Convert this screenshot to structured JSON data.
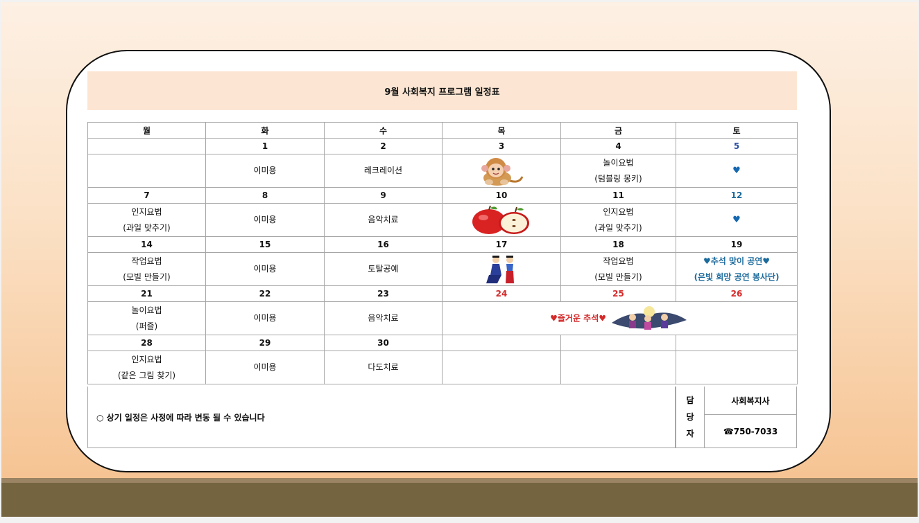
{
  "title": "9월 사회복지 프로그램 일정표",
  "weekdays": [
    "월",
    "화",
    "수",
    "목",
    "금",
    "토"
  ],
  "colors": {
    "saturday": "#1568b0",
    "holiday": "#d42a2a",
    "title_bg": "#fce6d3"
  },
  "week1": {
    "dates": [
      "",
      "1",
      "2",
      "3",
      "4",
      "5"
    ],
    "events": {
      "tue": "이미용",
      "wed": "레크레이션",
      "thu_icon": "monkey-illustration",
      "fri_line1": "놀이요법",
      "fri_line2": "(텀블링 몽키)",
      "sat": "♥"
    }
  },
  "week2": {
    "dates": [
      "7",
      "8",
      "9",
      "10",
      "11",
      "12"
    ],
    "events": {
      "mon_line1": "인지요법",
      "mon_line2": "(과일 맞추기)",
      "tue": "이미용",
      "wed": "음악치료",
      "thu_icon": "apple-illustration",
      "fri_line1": "인지요법",
      "fri_line2": "(과일 맞추기)",
      "sat": "♥"
    }
  },
  "week3": {
    "dates": [
      "14",
      "15",
      "16",
      "17",
      "18",
      "19"
    ],
    "events": {
      "mon_line1": "작업요법",
      "mon_line2": "(모빌 만들기)",
      "tue": "이미용",
      "wed": "토탈공예",
      "thu_icon": "hanbok-couple-illustration",
      "fri_line1": "작업요법",
      "fri_line2": "(모빌 만들기)",
      "sat_line1": "♥추석 맞이 공연♥",
      "sat_line2": "(은빛 희망 공연 봉사단)"
    }
  },
  "week4": {
    "dates": [
      "21",
      "22",
      "23",
      "24",
      "25",
      "26"
    ],
    "events": {
      "mon_line1": "놀이요법",
      "mon_line2": "(퍼즐)",
      "tue": "이미용",
      "wed": "음악치료",
      "holiday": "♥즐거운 추석♥",
      "holiday_icon": "full-moon-family-illustration"
    }
  },
  "week5": {
    "dates": [
      "28",
      "29",
      "30",
      "",
      "",
      ""
    ],
    "events": {
      "mon_line1": "인지요법",
      "mon_line2": "(같은 그림 찾기)",
      "tue": "이미용",
      "wed": "다도치료"
    }
  },
  "footer": {
    "note": "○ 상기 일정은 사정에 따라 변동 될 수 있습니다",
    "charge_chars": [
      "담",
      "당",
      "자"
    ],
    "role": "사회복지사",
    "phone": "☎750-7033"
  }
}
